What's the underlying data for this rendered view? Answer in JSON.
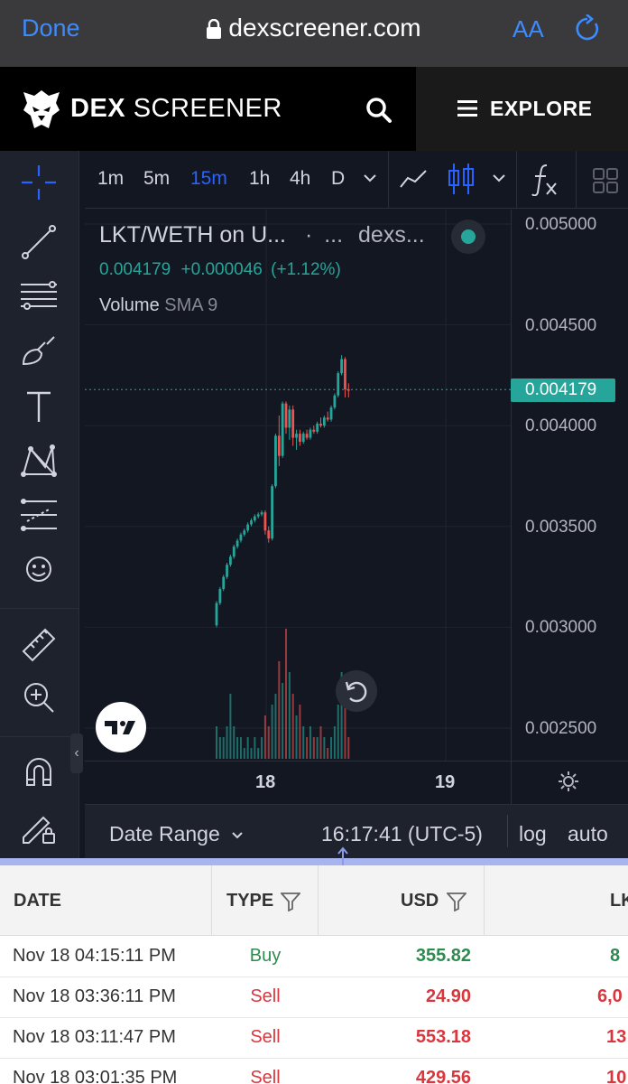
{
  "browser": {
    "done_label": "Done",
    "url": "dexscreener.com",
    "text_size_label": "AA"
  },
  "header": {
    "brand_bold": "DEX",
    "brand_light": "SCREENER",
    "explore_label": "EXPLORE"
  },
  "toolbar": {
    "timeframes": [
      "1m",
      "5m",
      "15m",
      "1h",
      "4h",
      "D"
    ],
    "active_timeframe": "15m"
  },
  "chart": {
    "pair": "LKT/WETH on U...",
    "sep_dots": "·",
    "ellipsis": "...",
    "source": "dexs...",
    "price": "0.004179",
    "change": "+0.000046",
    "change_pct": "(+1.12%)",
    "volume_label": "Volume",
    "volume_indicator": "SMA 9",
    "current_price_tag": "0.004179",
    "timezone_clock": "16:17:41 (UTC-5)",
    "date_range_label": "Date Range",
    "log_label": "log",
    "auto_label": "auto",
    "colors": {
      "up": "#26a69a",
      "down": "#ef5350"
    }
  },
  "chart_data": {
    "type": "candlestick",
    "y_ticks": [
      "0.005000",
      "0.004500",
      "0.004000",
      "0.003500",
      "0.003000",
      "0.002500"
    ],
    "x_ticks": [
      "18",
      "19"
    ],
    "ylim": [
      0.0024,
      0.00515
    ],
    "last_price": 0.004179,
    "candles": [
      {
        "o": 0.00301,
        "h": 0.00313,
        "l": 0.003,
        "c": 0.00312,
        "v": 3
      },
      {
        "o": 0.00312,
        "h": 0.0032,
        "l": 0.00311,
        "c": 0.00319,
        "v": 2
      },
      {
        "o": 0.00319,
        "h": 0.00326,
        "l": 0.00318,
        "c": 0.00325,
        "v": 2
      },
      {
        "o": 0.00325,
        "h": 0.00332,
        "l": 0.00324,
        "c": 0.00331,
        "v": 3
      },
      {
        "o": 0.00331,
        "h": 0.00336,
        "l": 0.0033,
        "c": 0.00335,
        "v": 6
      },
      {
        "o": 0.00335,
        "h": 0.00341,
        "l": 0.00334,
        "c": 0.0034,
        "v": 3
      },
      {
        "o": 0.0034,
        "h": 0.00344,
        "l": 0.00339,
        "c": 0.00343,
        "v": 2
      },
      {
        "o": 0.00343,
        "h": 0.00347,
        "l": 0.00342,
        "c": 0.00346,
        "v": 2
      },
      {
        "o": 0.00346,
        "h": 0.00349,
        "l": 0.00345,
        "c": 0.00348,
        "v": 1
      },
      {
        "o": 0.00348,
        "h": 0.00352,
        "l": 0.00347,
        "c": 0.00351,
        "v": 2
      },
      {
        "o": 0.00351,
        "h": 0.00354,
        "l": 0.0035,
        "c": 0.00353,
        "v": 1
      },
      {
        "o": 0.00353,
        "h": 0.00356,
        "l": 0.00352,
        "c": 0.00355,
        "v": 2
      },
      {
        "o": 0.00355,
        "h": 0.00357,
        "l": 0.00354,
        "c": 0.00356,
        "v": 1
      },
      {
        "o": 0.00356,
        "h": 0.00358,
        "l": 0.00355,
        "c": 0.00357,
        "v": 2
      },
      {
        "o": 0.00357,
        "h": 0.00358,
        "l": 0.00346,
        "c": 0.00348,
        "v": 4
      },
      {
        "o": 0.00348,
        "h": 0.0035,
        "l": 0.00342,
        "c": 0.00344,
        "v": 3
      },
      {
        "o": 0.00344,
        "h": 0.00371,
        "l": 0.00343,
        "c": 0.0037,
        "v": 5
      },
      {
        "o": 0.0037,
        "h": 0.00396,
        "l": 0.00369,
        "c": 0.00395,
        "v": 6
      },
      {
        "o": 0.00395,
        "h": 0.00405,
        "l": 0.0038,
        "c": 0.00385,
        "v": 9
      },
      {
        "o": 0.00385,
        "h": 0.00412,
        "l": 0.00384,
        "c": 0.00411,
        "v": 7
      },
      {
        "o": 0.00411,
        "h": 0.00412,
        "l": 0.00396,
        "c": 0.00399,
        "v": 12
      },
      {
        "o": 0.00399,
        "h": 0.0041,
        "l": 0.00393,
        "c": 0.00408,
        "v": 8
      },
      {
        "o": 0.00408,
        "h": 0.0041,
        "l": 0.0039,
        "c": 0.00394,
        "v": 6
      },
      {
        "o": 0.00394,
        "h": 0.00398,
        "l": 0.00388,
        "c": 0.00396,
        "v": 4
      },
      {
        "o": 0.00396,
        "h": 0.00398,
        "l": 0.0039,
        "c": 0.00392,
        "v": 5
      },
      {
        "o": 0.00392,
        "h": 0.00397,
        "l": 0.00391,
        "c": 0.00396,
        "v": 3
      },
      {
        "o": 0.00396,
        "h": 0.00398,
        "l": 0.00393,
        "c": 0.00394,
        "v": 2
      },
      {
        "o": 0.00394,
        "h": 0.00399,
        "l": 0.00393,
        "c": 0.00398,
        "v": 3
      },
      {
        "o": 0.00398,
        "h": 0.004,
        "l": 0.00396,
        "c": 0.00397,
        "v": 2
      },
      {
        "o": 0.00397,
        "h": 0.00402,
        "l": 0.00396,
        "c": 0.00401,
        "v": 2
      },
      {
        "o": 0.00401,
        "h": 0.00404,
        "l": 0.00399,
        "c": 0.004,
        "v": 3
      },
      {
        "o": 0.004,
        "h": 0.00405,
        "l": 0.00399,
        "c": 0.00404,
        "v": 2
      },
      {
        "o": 0.00404,
        "h": 0.00407,
        "l": 0.00402,
        "c": 0.00403,
        "v": 1
      },
      {
        "o": 0.00403,
        "h": 0.0041,
        "l": 0.00402,
        "c": 0.00409,
        "v": 2
      },
      {
        "o": 0.00409,
        "h": 0.00416,
        "l": 0.00408,
        "c": 0.00415,
        "v": 3
      },
      {
        "o": 0.00415,
        "h": 0.00427,
        "l": 0.00414,
        "c": 0.00426,
        "v": 5
      },
      {
        "o": 0.00426,
        "h": 0.00435,
        "l": 0.00425,
        "c": 0.00433,
        "v": 8
      },
      {
        "o": 0.00433,
        "h": 0.00434,
        "l": 0.00414,
        "c": 0.00418,
        "v": 7
      },
      {
        "o": 0.00418,
        "h": 0.00421,
        "l": 0.00414,
        "c": 0.004179,
        "v": 2
      }
    ]
  },
  "trades": {
    "headers": {
      "date": "DATE",
      "type": "TYPE",
      "usd": "USD",
      "lkt": "LK"
    },
    "rows": [
      {
        "date": "Nov 18 04:15:11 PM",
        "type": "Buy",
        "usd": "355.82",
        "lkt": "8"
      },
      {
        "date": "Nov 18 03:36:11 PM",
        "type": "Sell",
        "usd": "24.90",
        "lkt": "6,0"
      },
      {
        "date": "Nov 18 03:11:47 PM",
        "type": "Sell",
        "usd": "553.18",
        "lkt": "13"
      },
      {
        "date": "Nov 18 03:01:35 PM",
        "type": "Sell",
        "usd": "429.56",
        "lkt": "10"
      }
    ]
  }
}
